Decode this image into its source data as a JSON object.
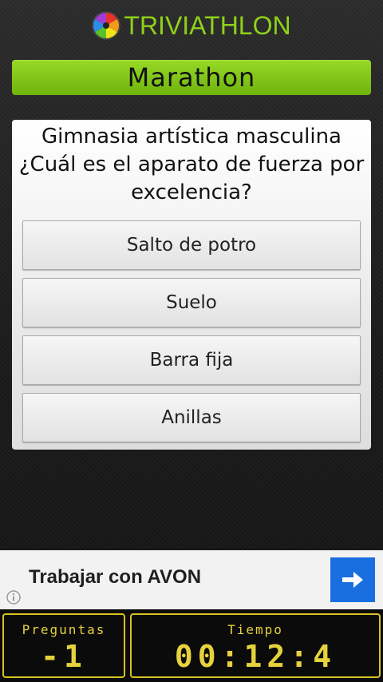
{
  "header": {
    "title": "TRIVIATHLON",
    "logo_icon": "triviathlon-wheel-logo"
  },
  "mode": {
    "label": "Marathon"
  },
  "question": {
    "text": "Gimnasia artística masculina ¿Cuál es el aparato de fuerza por excelencia?"
  },
  "answers": [
    {
      "label": "Salto de potro"
    },
    {
      "label": "Suelo"
    },
    {
      "label": "Barra fija"
    },
    {
      "label": "Anillas"
    }
  ],
  "ad": {
    "text": "Trabajar con AVON",
    "arrow_icon": "arrow-right-icon",
    "info_icon": "info-icon"
  },
  "scoreboard": {
    "questions_label": "Preguntas",
    "questions_value": "-1",
    "time_label": "Tiempo",
    "time_value": "00:12:4"
  },
  "colors": {
    "accent_green": "#8fd11a",
    "mode_bar": "#7fc317",
    "scoreboard_yellow": "#d9c21f",
    "ad_blue": "#1a6fe0"
  }
}
